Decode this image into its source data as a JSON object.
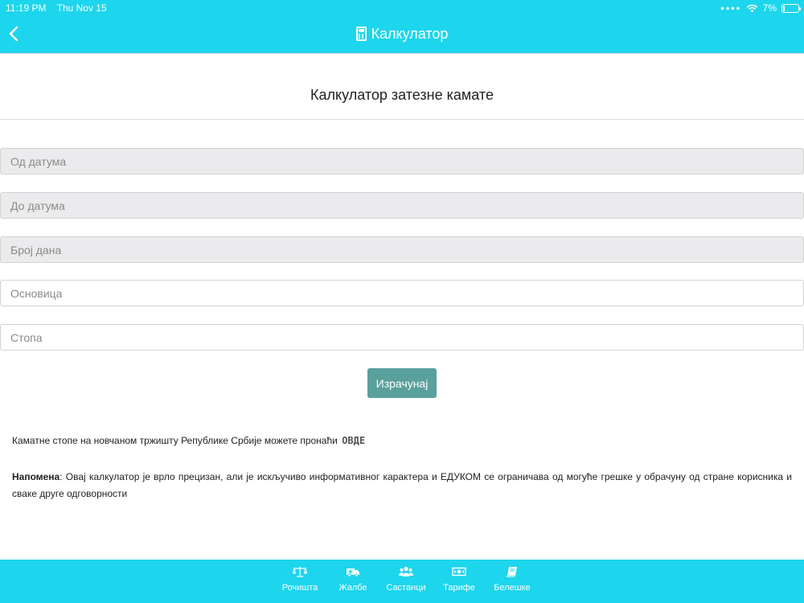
{
  "status": {
    "time": "11:19 PM",
    "date": "Thu Nov 15",
    "battery": "7%"
  },
  "header": {
    "back_icon": "chevron-left-icon",
    "title_icon": "calculator-icon",
    "title": "Калкулатор"
  },
  "page": {
    "title": "Калкулатор затезне камате"
  },
  "form": {
    "from_date_placeholder": "Од датума",
    "to_date_placeholder": "До датума",
    "days_placeholder": "Број дана",
    "base_placeholder": "Основица",
    "rate_placeholder": "Стопа",
    "calculate_label": "Израчунај"
  },
  "info": {
    "text": "Каматне стопе на новчаном тржишту Републике Србије можете пронаћи",
    "link": "ОВДЕ"
  },
  "note": {
    "label": "Напомена",
    "text": ": Овај калкулатор је врло прецизан, али је искључиво информативног карактера и ЕДУКОМ се ограничава од могуће грешке у обрачуну од стране корисника и сваке друге одговорности"
  },
  "tabs": [
    {
      "label": "Рочишта",
      "icon": "scales-icon"
    },
    {
      "label": "Жалбе",
      "icon": "ambulance-icon"
    },
    {
      "label": "Састанци",
      "icon": "users-icon"
    },
    {
      "label": "Тарифе",
      "icon": "money-icon"
    },
    {
      "label": "Белешке",
      "icon": "book-icon"
    }
  ],
  "colors": {
    "accent": "#1dd5ec",
    "button": "#5aa09c",
    "disabled_field": "#ebebed"
  }
}
